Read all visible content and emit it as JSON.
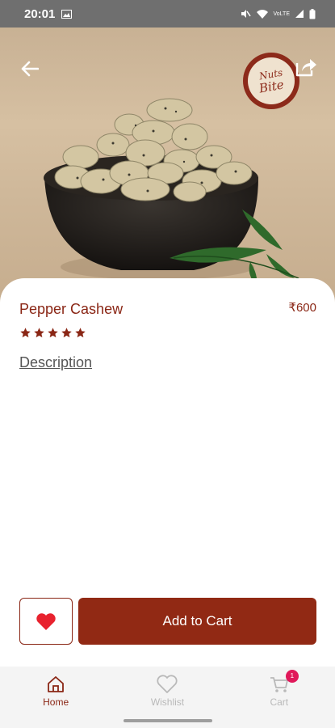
{
  "status_bar": {
    "time": "20:01",
    "icons": [
      "image-icon",
      "mute-icon",
      "wifi-icon",
      "signal-icon",
      "battery-icon"
    ],
    "network_label": "VoLTE"
  },
  "header": {
    "back_icon": "arrow-left-icon",
    "share_icon": "share-icon",
    "brand": {
      "line1": "Nuts",
      "line2": "Bite"
    }
  },
  "product": {
    "name": "Pepper Cashew",
    "price": "₹600",
    "rating": 5,
    "rating_max": 5,
    "description_link": "Description"
  },
  "actions": {
    "wishlist_icon": "heart-icon",
    "add_to_cart_label": "Add to Cart"
  },
  "bottom_nav": {
    "items": [
      {
        "label": "Home",
        "icon": "home-icon",
        "active": true
      },
      {
        "label": "Wishlist",
        "icon": "heart-outline-icon",
        "active": false
      },
      {
        "label": "Cart",
        "icon": "cart-icon",
        "active": false,
        "badge": "1"
      }
    ]
  },
  "colors": {
    "brand": "#912914",
    "accent_text": "#8a2615",
    "badge": "#e0185a",
    "status_bar": "#6f6f6f"
  }
}
